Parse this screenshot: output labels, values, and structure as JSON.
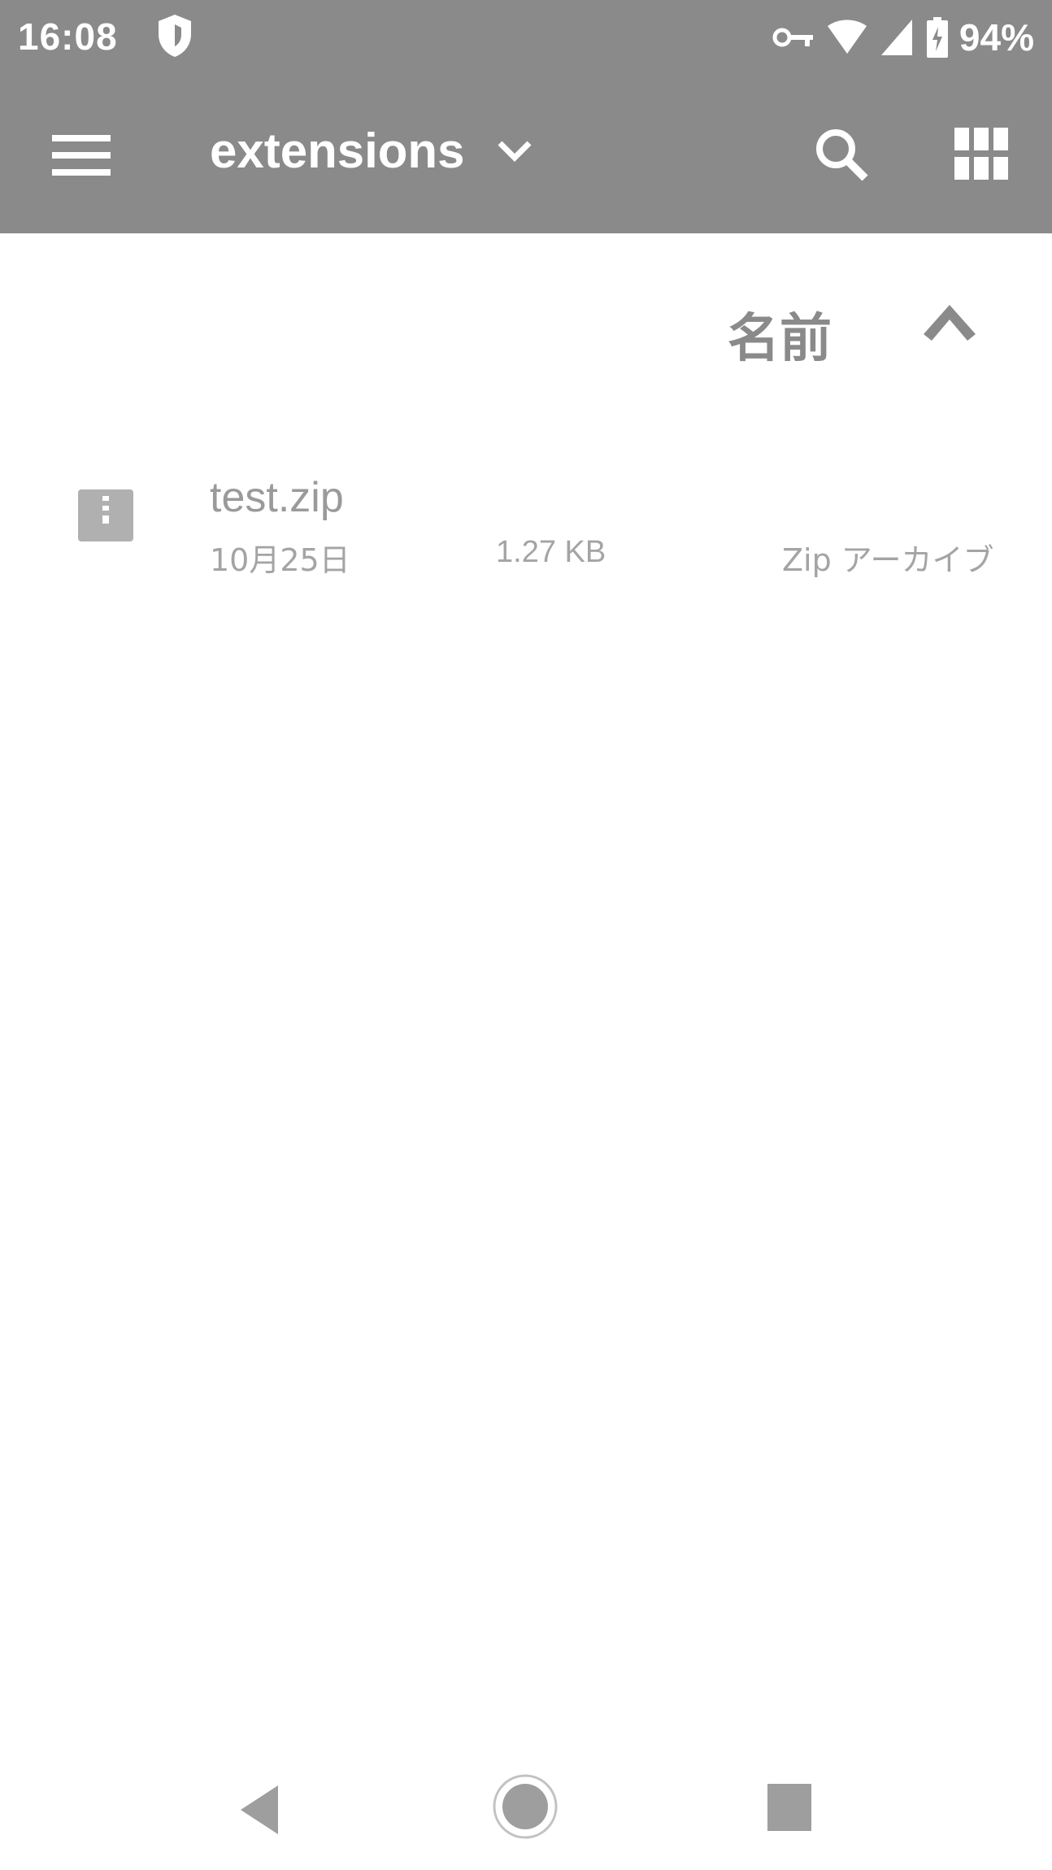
{
  "status_bar": {
    "time": "16:08",
    "battery_percent": "94%",
    "icons": [
      "shield-icon",
      "vpn-key-icon",
      "wifi-icon",
      "signal-icon",
      "battery-icon"
    ]
  },
  "app_bar": {
    "title": "extensions",
    "icons": [
      "menu-icon",
      "dropdown-chevron-icon",
      "search-icon",
      "grid-view-icon"
    ]
  },
  "sort": {
    "label": "名前",
    "direction_icon": "chevron-up-icon"
  },
  "files": [
    {
      "name": "test.zip",
      "date": "10月25日",
      "size": "1.27 KB",
      "type": "Zip アーカイブ",
      "icon": "zip-file-icon"
    }
  ],
  "nav_bar": {
    "icons": [
      "back-icon",
      "home-icon",
      "recents-icon"
    ]
  },
  "colors": {
    "app_bar": "#8a8a8a",
    "text_secondary": "#a4a4a4",
    "background": "#ffffff"
  }
}
